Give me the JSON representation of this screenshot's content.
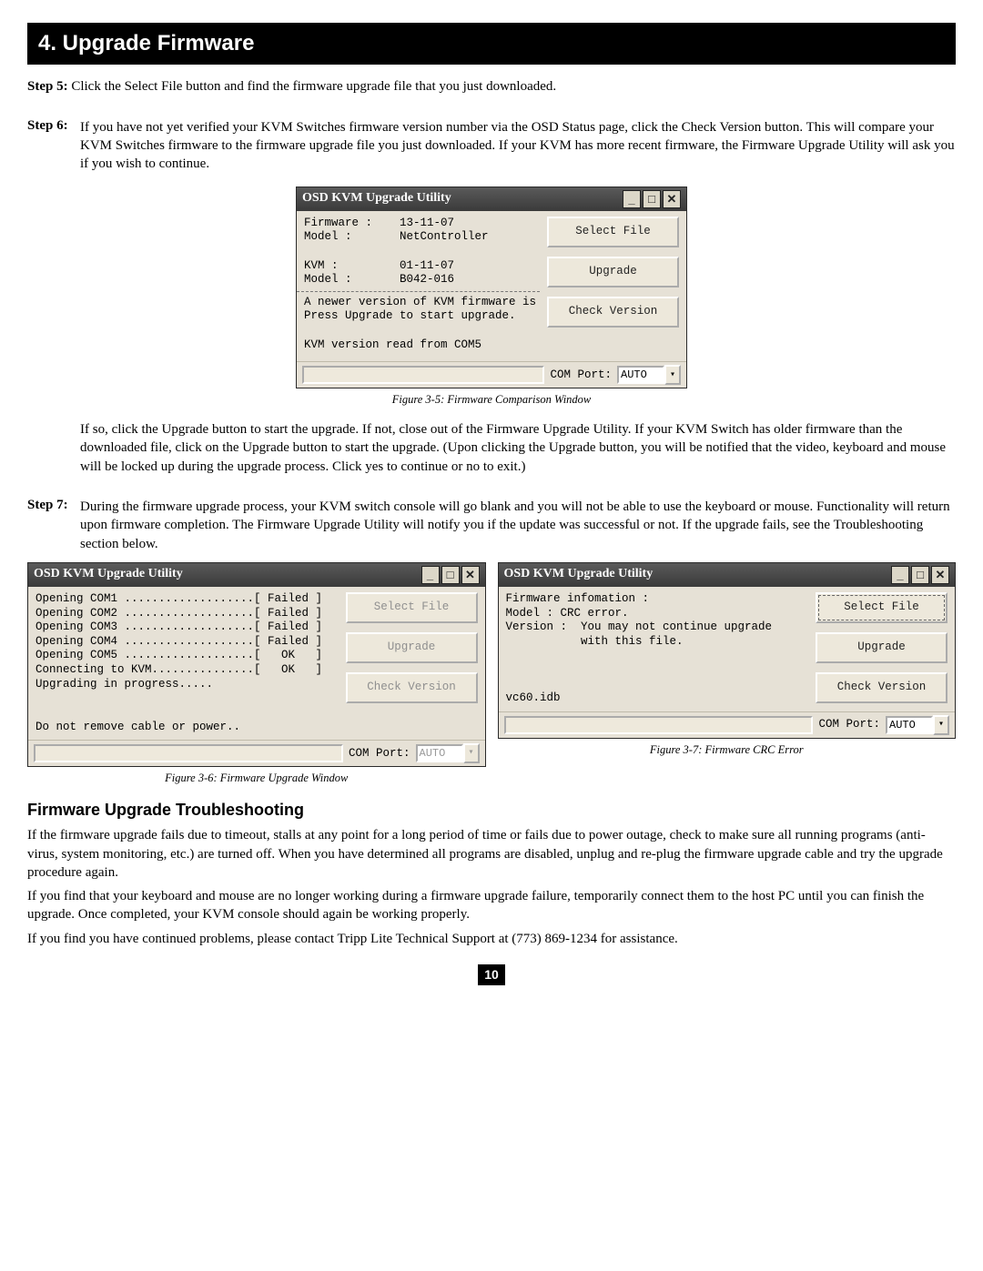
{
  "page": {
    "number": "10"
  },
  "section": {
    "title": "4. Upgrade Firmware"
  },
  "steps": {
    "s5": {
      "label": "Step 5:",
      "text": "Click the Select File button and find the firmware upgrade file that you just downloaded."
    },
    "s6": {
      "label": "Step 6:",
      "text": "If you have not yet verified your KVM Switches firmware version number via the OSD Status page, click the Check Version button. This will compare your KVM Switches firmware to the firmware upgrade file you just downloaded. If your KVM has more recent firmware, the Firmware Upgrade Utility will ask you if you wish to continue.",
      "after_text": "If so, click the Upgrade button to start the upgrade. If not, close out of the Firmware Upgrade Utility. If your KVM Switch has older firmware than the downloaded file, click on the Upgrade button to start the upgrade. (Upon clicking the Upgrade button, you will be notified that the video, keyboard and mouse will be locked up during the upgrade process. Click yes to continue or no to exit.)"
    },
    "s7": {
      "label": "Step 7:",
      "text": "During the firmware upgrade process, your KVM switch console will go blank and you will not be able to use the keyboard or mouse. Functionality will return upon firmware completion. The Firmware Upgrade Utility will notify you if the update was successful or not. If the upgrade fails, see the Troubleshooting section below."
    }
  },
  "window_common": {
    "title": "OSD KVM Upgrade Utility",
    "btn_select": "Select File",
    "btn_upgrade": "Upgrade",
    "btn_check": "Check Version",
    "comport_label": "COM Port:",
    "comport_value": "AUTO"
  },
  "figures": {
    "f35": {
      "caption": "Figure 3-5: Firmware Comparison Window",
      "body_top": "Firmware :    13-11-07\nModel :       NetController\n\nKVM :         01-11-07\nModel :       B042-016",
      "body_mid": "A newer version of KVM firmware is available.\nPress Upgrade to start upgrade.\n\nKVM version read from COM5"
    },
    "f36": {
      "caption": "Figure 3-6: Firmware Upgrade Window",
      "body": "Opening COM1 ...................[ Failed ]\nOpening COM2 ...................[ Failed ]\nOpening COM3 ...................[ Failed ]\nOpening COM4 ...................[ Failed ]\nOpening COM5 ...................[   OK   ]\nConnecting to KVM...............[   OK   ]\nUpgrading in progress.....\n\n\nDo not remove cable or power.."
    },
    "f37": {
      "caption": "Figure 3-7: Firmware CRC Error",
      "body": "Firmware infomation :\nModel : CRC error.\nVersion :  You may not continue upgrade\n           with this file.\n\n\n\nvc60.idb"
    }
  },
  "troubleshoot": {
    "heading": "Firmware Upgrade Troubleshooting",
    "p1": "If the firmware upgrade fails due to timeout, stalls at any point for a long period of time or fails due to power outage, check to make sure all running programs (anti-virus, system monitoring, etc.) are turned off. When you have determined all programs are disabled, unplug and re-plug the firmware upgrade cable and try the upgrade procedure again.",
    "p2": "If you find that your keyboard and mouse are no longer working during a firmware upgrade failure, temporarily connect them to the host PC until you can finish the upgrade. Once completed, your KVM console should again be working properly.",
    "p3": "If you find you have continued problems, please contact Tripp Lite Technical Support at (773) 869-1234 for assistance."
  }
}
